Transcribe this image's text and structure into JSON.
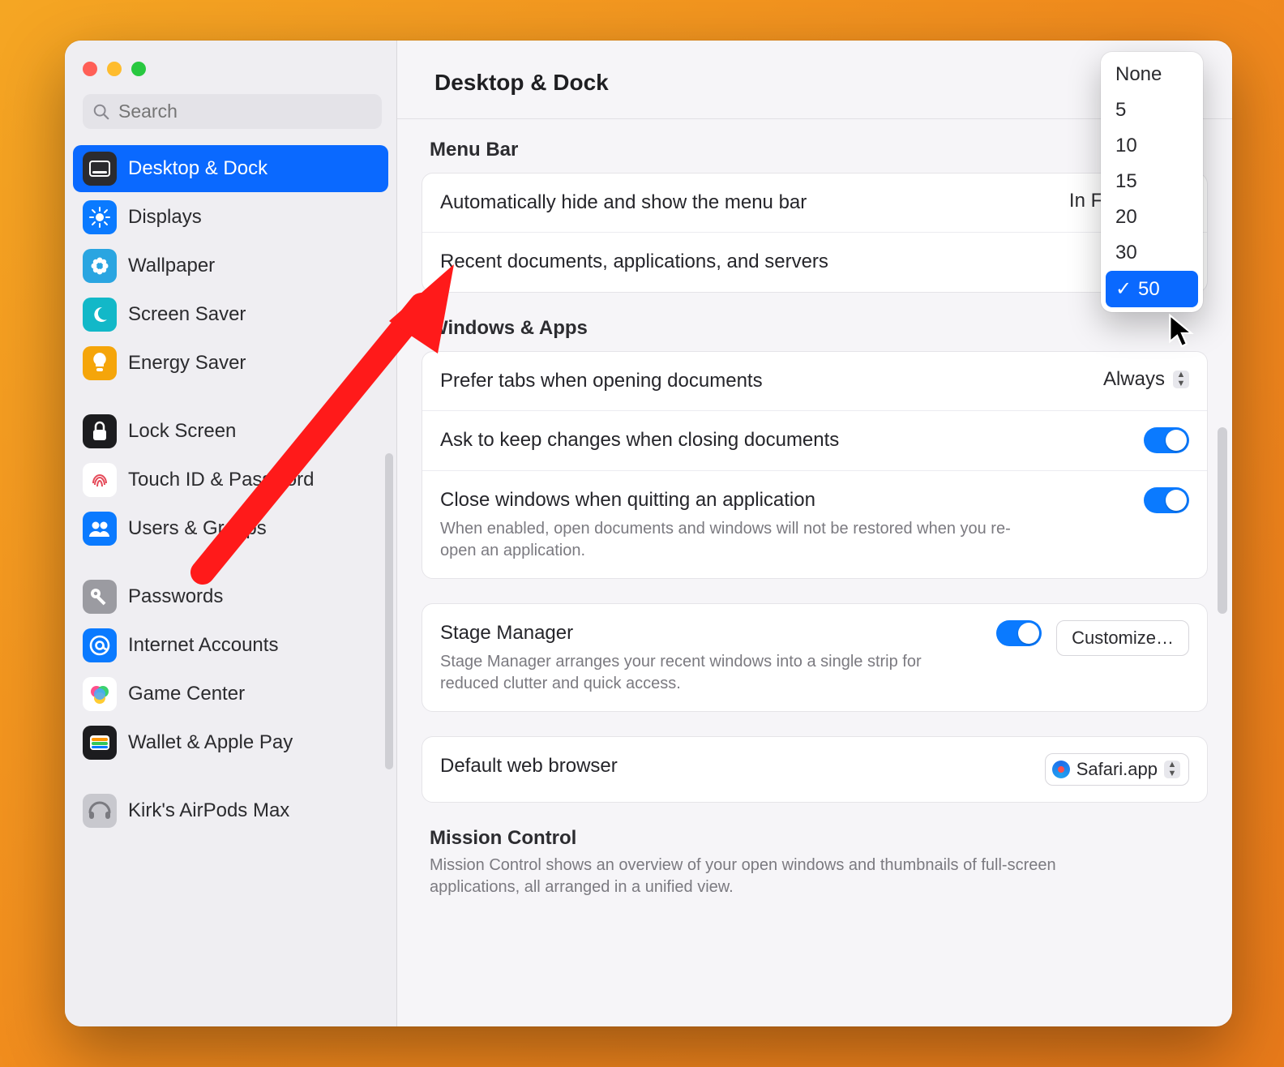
{
  "window": {
    "title": "Desktop & Dock",
    "search_placeholder": "Search"
  },
  "sidebar": {
    "items": [
      {
        "key": "desktop-dock",
        "label": "Desktop & Dock",
        "selected": true,
        "iconBg": "#2b2b2e",
        "glyph": "dock"
      },
      {
        "key": "displays",
        "label": "Displays",
        "iconBg": "#0a7aff",
        "glyph": "sun"
      },
      {
        "key": "wallpaper",
        "label": "Wallpaper",
        "iconBg": "#2aa5e1",
        "glyph": "flower"
      },
      {
        "key": "screen-saver",
        "label": "Screen Saver",
        "iconBg": "#12b8c8",
        "glyph": "moon"
      },
      {
        "key": "energy-saver",
        "label": "Energy Saver",
        "iconBg": "#f5a50a",
        "glyph": "bulb"
      },
      {
        "gap": true
      },
      {
        "key": "lock-screen",
        "label": "Lock Screen",
        "iconBg": "#1c1c1f",
        "glyph": "lock"
      },
      {
        "key": "touch-id",
        "label": "Touch ID & Password",
        "iconBg": "#ffffff",
        "glyph": "fingerprint"
      },
      {
        "key": "users-groups",
        "label": "Users & Groups",
        "iconBg": "#0a7aff",
        "glyph": "people"
      },
      {
        "gap": true
      },
      {
        "key": "passwords",
        "label": "Passwords",
        "iconBg": "#9b9ba1",
        "glyph": "key"
      },
      {
        "key": "internet-acct",
        "label": "Internet Accounts",
        "iconBg": "#0a7aff",
        "glyph": "at"
      },
      {
        "key": "game-center",
        "label": "Game Center",
        "iconBg": "#ffffff",
        "glyph": "gamecenter"
      },
      {
        "key": "wallet-pay",
        "label": "Wallet & Apple Pay",
        "iconBg": "#1c1c1f",
        "glyph": "wallet"
      },
      {
        "gap": true
      },
      {
        "key": "airpods",
        "label": "Kirk's AirPods Max",
        "iconBg": "#c8c8ce",
        "glyph": "airpods"
      }
    ]
  },
  "menubar": {
    "section_title": "Menu Bar",
    "autohide": {
      "label": "Automatically hide and show the menu bar",
      "value": "In Full Screen"
    },
    "recent": {
      "label": "Recent documents, applications, and servers",
      "value": "50"
    }
  },
  "windows_apps": {
    "section_title": "Windows & Apps",
    "prefer_tabs": {
      "label": "Prefer tabs when opening documents",
      "value": "Always"
    },
    "ask_keep": {
      "label": "Ask to keep changes when closing documents",
      "on": true
    },
    "close_quit": {
      "label": "Close windows when quitting an application",
      "desc": "When enabled, open documents and windows will not be restored when you re-open an application.",
      "on": true
    },
    "stage": {
      "label": "Stage Manager",
      "desc": "Stage Manager arranges your recent windows into a single strip for reduced clutter and quick access.",
      "on": true,
      "button": "Customize…"
    },
    "browser": {
      "label": "Default web browser",
      "value": "Safari.app"
    }
  },
  "mission": {
    "section_title": "Mission Control",
    "desc": "Mission Control shows an overview of your open windows and thumbnails of full-screen applications, all arranged in a unified view."
  },
  "dropdown": {
    "options": [
      "None",
      "5",
      "10",
      "15",
      "20",
      "30",
      "50"
    ],
    "selected": "50"
  }
}
